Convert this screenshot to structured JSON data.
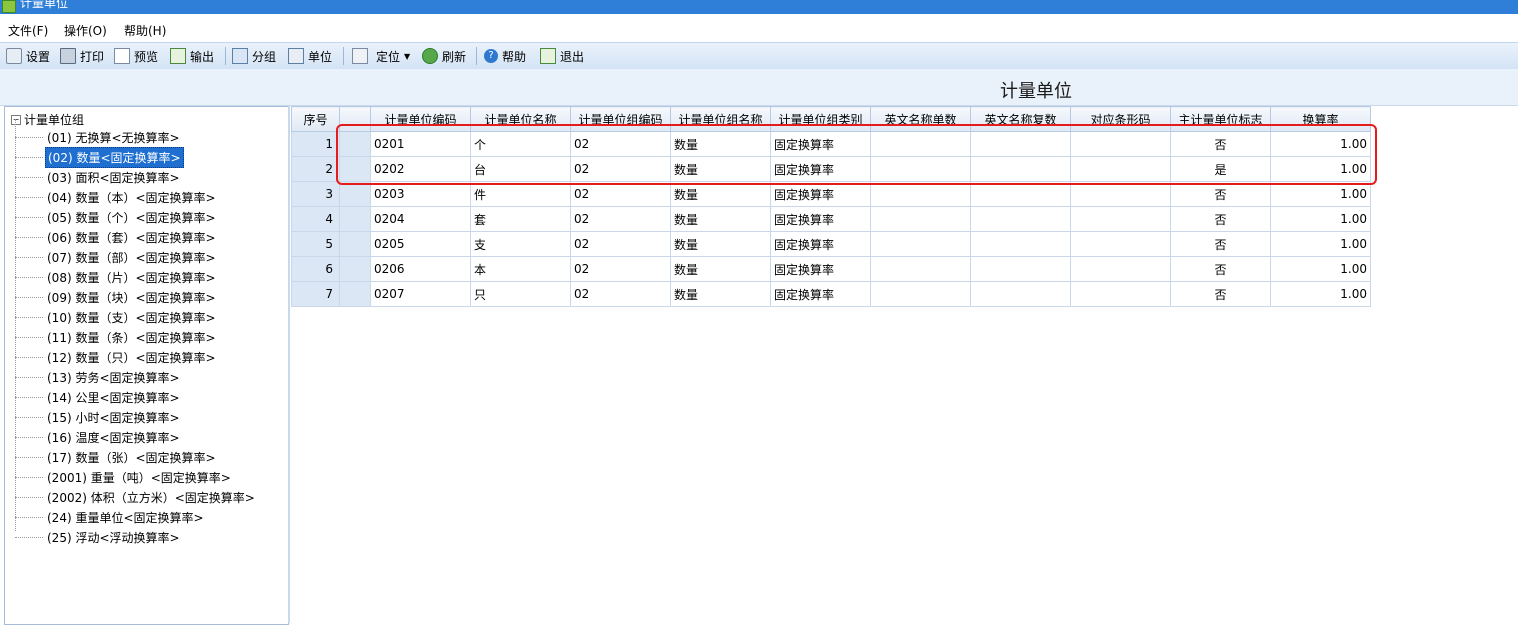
{
  "window": {
    "title": "计量单位"
  },
  "menu": {
    "items": [
      "文件(F)",
      "操作(O)",
      "帮助(H)"
    ]
  },
  "toolbar": {
    "settings": "设置",
    "print": "打印",
    "preview": "预览",
    "export": "输出",
    "group": "分组",
    "unit": "单位",
    "locate": "定位",
    "refresh": "刷新",
    "help": "帮助",
    "exit": "退出"
  },
  "page_title": "计量单位",
  "tree": {
    "root": "计量单位组",
    "items": [
      "(01) 无换算<无换算率>",
      "(02) 数量<固定换算率>",
      "(03) 面积<固定换算率>",
      "(04) 数量（本）<固定换算率>",
      "(05) 数量（个）<固定换算率>",
      "(06) 数量（套）<固定换算率>",
      "(07) 数量（部）<固定换算率>",
      "(08) 数量（片）<固定换算率>",
      "(09) 数量（块）<固定换算率>",
      "(10) 数量（支）<固定换算率>",
      "(11) 数量（条）<固定换算率>",
      "(12) 数量（只）<固定换算率>",
      "(13) 劳务<固定换算率>",
      "(14) 公里<固定换算率>",
      "(15) 小时<固定换算率>",
      "(16) 温度<固定换算率>",
      "(17) 数量（张）<固定换算率>",
      "(2001) 重量（吨）<固定换算率>",
      "(2002) 体积（立方米）<固定换算率>",
      "(24) 重量单位<固定换算率>",
      "(25) 浮动<浮动换算率>"
    ]
  },
  "table": {
    "headers": [
      "序号",
      "",
      "计量单位编码",
      "计量单位名称",
      "计量单位组编码",
      "计量单位组名称",
      "计量单位组类别",
      "英文名称单数",
      "英文名称复数",
      "对应条形码",
      "主计量单位标志",
      "换算率"
    ],
    "rows": [
      [
        "1",
        "",
        "0201",
        "个",
        "02",
        "数量",
        "固定换算率",
        "",
        "",
        "",
        "否",
        "1.00"
      ],
      [
        "2",
        "",
        "0202",
        "台",
        "02",
        "数量",
        "固定换算率",
        "",
        "",
        "",
        "是",
        "1.00"
      ],
      [
        "3",
        "",
        "0203",
        "件",
        "02",
        "数量",
        "固定换算率",
        "",
        "",
        "",
        "否",
        "1.00"
      ],
      [
        "4",
        "",
        "0204",
        "套",
        "02",
        "数量",
        "固定换算率",
        "",
        "",
        "",
        "否",
        "1.00"
      ],
      [
        "5",
        "",
        "0205",
        "支",
        "02",
        "数量",
        "固定换算率",
        "",
        "",
        "",
        "否",
        "1.00"
      ],
      [
        "6",
        "",
        "0206",
        "本",
        "02",
        "数量",
        "固定换算率",
        "",
        "",
        "",
        "否",
        "1.00"
      ],
      [
        "7",
        "",
        "0207",
        "只",
        "02",
        "数量",
        "固定换算率",
        "",
        "",
        "",
        "否",
        "1.00"
      ]
    ]
  },
  "colors": {
    "accent": "#2f7fd8",
    "selection": "#1f6fd1",
    "annotation": "#e51c1c"
  }
}
